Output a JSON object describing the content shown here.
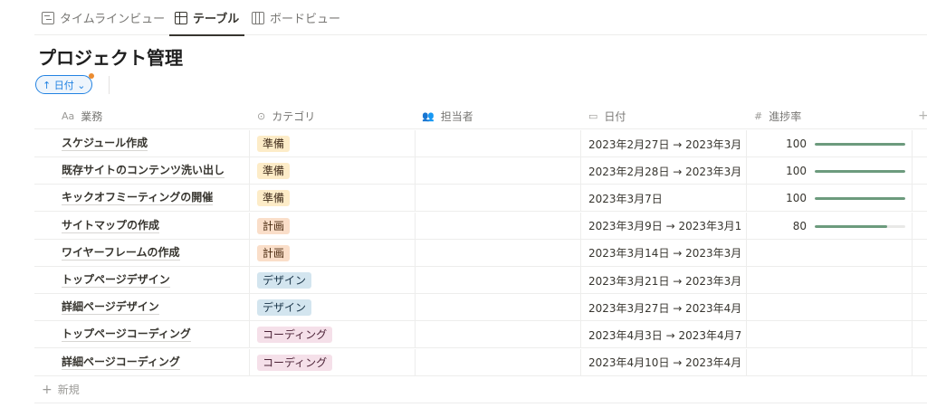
{
  "tabs": [
    {
      "label": "タイムラインビュー",
      "icon": "timeline-icon",
      "active": false
    },
    {
      "label": "テーブル",
      "icon": "table-icon",
      "active": true
    },
    {
      "label": "ボードビュー",
      "icon": "board-icon",
      "active": false
    }
  ],
  "page": {
    "title": "プロジェクト管理"
  },
  "sort": {
    "label": "↑ 日付 ⌄"
  },
  "columns": {
    "name": {
      "icon": "Aa",
      "label": "業務"
    },
    "category": {
      "icon": "⊙",
      "label": "カテゴリ"
    },
    "assignee": {
      "icon": "👥",
      "label": "担当者"
    },
    "date": {
      "icon": "▭",
      "label": "日付"
    },
    "progress": {
      "icon": "#",
      "label": "進捗率"
    },
    "add": "+"
  },
  "category_colors": {
    "準備": {
      "bg": "#fdecc8",
      "fg": "#402c1b"
    },
    "計画": {
      "bg": "#fadec9",
      "fg": "#49290e"
    },
    "デザイン": {
      "bg": "#d3e5ef",
      "fg": "#183347"
    },
    "コーディング": {
      "bg": "#f5e0e9",
      "fg": "#4c2337"
    }
  },
  "progress_color": "#6c9b7d",
  "rows": [
    {
      "name": "スケジュール作成",
      "category": "準備",
      "date": "2023年2月27日 → 2023年3月",
      "progress": "100",
      "progress_fraction": 1.0
    },
    {
      "name": "既存サイトのコンテンツ洗い出し",
      "category": "準備",
      "date": "2023年2月28日 → 2023年3月",
      "progress": "100",
      "progress_fraction": 1.0
    },
    {
      "name": "キックオフミーティングの開催",
      "category": "準備",
      "date": "2023年3月7日",
      "progress": "100",
      "progress_fraction": 1.0
    },
    {
      "name": "サイトマップの作成",
      "category": "計画",
      "date": "2023年3月9日 → 2023年3月1",
      "progress": "80",
      "progress_fraction": 0.8
    },
    {
      "name": "ワイヤーフレームの作成",
      "category": "計画",
      "date": "2023年3月14日 → 2023年3月",
      "progress": "",
      "progress_fraction": null
    },
    {
      "name": "トップページデザイン",
      "category": "デザイン",
      "date": "2023年3月21日 → 2023年3月",
      "progress": "",
      "progress_fraction": null
    },
    {
      "name": "詳細ページデザイン",
      "category": "デザイン",
      "date": "2023年3月27日 → 2023年4月",
      "progress": "",
      "progress_fraction": null
    },
    {
      "name": "トップページコーディング",
      "category": "コーディング",
      "date": "2023年4月3日 → 2023年4月7",
      "progress": "",
      "progress_fraction": null
    },
    {
      "name": "詳細ページコーディング",
      "category": "コーディング",
      "date": "2023年4月10日 → 2023年4月",
      "progress": "",
      "progress_fraction": null
    }
  ],
  "new_row": {
    "icon": "+",
    "label": "新規"
  }
}
